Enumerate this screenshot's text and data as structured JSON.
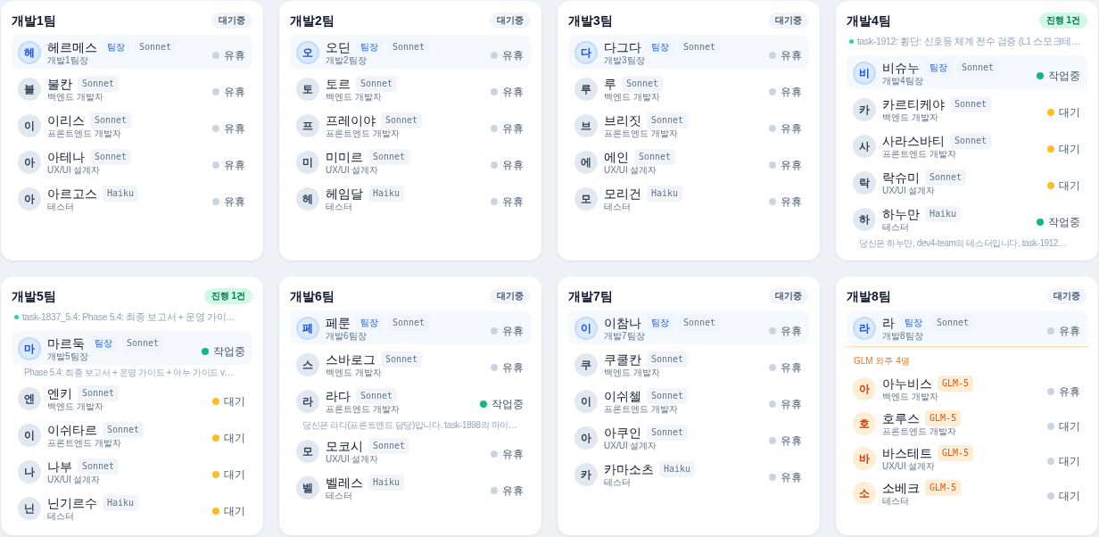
{
  "teams": [
    {
      "title": "개발1팀",
      "badge": {
        "text": "대기중",
        "active": false
      },
      "members": [
        {
          "kind": "leader",
          "initial": "헤",
          "name": "헤르메스",
          "tags": [
            {
              "text": "팀장",
              "kind": "role"
            },
            {
              "text": "Sonnet",
              "kind": "model"
            }
          ],
          "role": "개발1팀장",
          "status": "유휴",
          "color": "#cbd5e1"
        },
        {
          "kind": "member",
          "initial": "불",
          "name": "불칸",
          "tags": [
            {
              "text": "Sonnet",
              "kind": "model"
            }
          ],
          "role": "백엔드 개발자",
          "status": "유휴",
          "color": "#cbd5e1"
        },
        {
          "kind": "member",
          "initial": "이",
          "name": "이리스",
          "tags": [
            {
              "text": "Sonnet",
              "kind": "model"
            }
          ],
          "role": "프론트엔드 개발자",
          "status": "유휴",
          "color": "#cbd5e1"
        },
        {
          "kind": "member",
          "initial": "아",
          "name": "아테나",
          "tags": [
            {
              "text": "Sonnet",
              "kind": "model"
            }
          ],
          "role": "UX/UI 설계자",
          "status": "유휴",
          "color": "#cbd5e1"
        },
        {
          "kind": "member",
          "initial": "아",
          "name": "아르고스",
          "tags": [
            {
              "text": "Haiku",
              "kind": "model"
            }
          ],
          "role": "테스터",
          "status": "유휴",
          "color": "#cbd5e1"
        }
      ]
    },
    {
      "title": "개발2팀",
      "badge": {
        "text": "대기중",
        "active": false
      },
      "members": [
        {
          "kind": "leader",
          "initial": "오",
          "name": "오딘",
          "tags": [
            {
              "text": "팀장",
              "kind": "role"
            },
            {
              "text": "Sonnet",
              "kind": "model"
            }
          ],
          "role": "개발2팀장",
          "status": "유휴",
          "color": "#cbd5e1"
        },
        {
          "kind": "member",
          "initial": "토",
          "name": "토르",
          "tags": [
            {
              "text": "Sonnet",
              "kind": "model"
            }
          ],
          "role": "백엔드 개발자",
          "status": "유휴",
          "color": "#cbd5e1"
        },
        {
          "kind": "member",
          "initial": "프",
          "name": "프레이야",
          "tags": [
            {
              "text": "Sonnet",
              "kind": "model"
            }
          ],
          "role": "프론트엔드 개발자",
          "status": "유휴",
          "color": "#cbd5e1"
        },
        {
          "kind": "member",
          "initial": "미",
          "name": "미미르",
          "tags": [
            {
              "text": "Sonnet",
              "kind": "model"
            }
          ],
          "role": "UX/UI 설계자",
          "status": "유휴",
          "color": "#cbd5e1"
        },
        {
          "kind": "member",
          "initial": "헤",
          "name": "헤임달",
          "tags": [
            {
              "text": "Haiku",
              "kind": "model"
            }
          ],
          "role": "테스터",
          "status": "유휴",
          "color": "#cbd5e1"
        }
      ]
    },
    {
      "title": "개발3팀",
      "badge": {
        "text": "대기중",
        "active": false
      },
      "members": [
        {
          "kind": "leader",
          "initial": "다",
          "name": "다그다",
          "tags": [
            {
              "text": "팀장",
              "kind": "role"
            },
            {
              "text": "Sonnet",
              "kind": "model"
            }
          ],
          "role": "개발3팀장",
          "status": "유휴",
          "color": "#cbd5e1"
        },
        {
          "kind": "member",
          "initial": "루",
          "name": "루",
          "tags": [
            {
              "text": "Sonnet",
              "kind": "model"
            }
          ],
          "role": "백엔드 개발자",
          "status": "유휴",
          "color": "#cbd5e1"
        },
        {
          "kind": "member",
          "initial": "브",
          "name": "브리짓",
          "tags": [
            {
              "text": "Sonnet",
              "kind": "model"
            }
          ],
          "role": "프론트엔드 개발자",
          "status": "유휴",
          "color": "#cbd5e1"
        },
        {
          "kind": "member",
          "initial": "에",
          "name": "에인",
          "tags": [
            {
              "text": "Sonnet",
              "kind": "model"
            }
          ],
          "role": "UX/UI 설계자",
          "status": "유휴",
          "color": "#cbd5e1"
        },
        {
          "kind": "member",
          "initial": "모",
          "name": "모리건",
          "tags": [
            {
              "text": "Haiku",
              "kind": "model"
            }
          ],
          "role": "테스터",
          "status": "유휴",
          "color": "#cbd5e1"
        }
      ]
    },
    {
      "title": "개발4팀",
      "badge": {
        "text": "진행 1건",
        "active": true
      },
      "task": "task-1912: 횡단: 신호등 체계 전수 검증 (L1 스모크테…",
      "members": [
        {
          "kind": "leader",
          "initial": "비",
          "name": "비슈누",
          "tags": [
            {
              "text": "팀장",
              "kind": "role"
            },
            {
              "text": "Sonnet",
              "kind": "model"
            }
          ],
          "role": "개발4팀장",
          "status": "작업중",
          "color": "#10b981"
        },
        {
          "kind": "member",
          "initial": "카",
          "name": "카르티케야",
          "tags": [
            {
              "text": "Sonnet",
              "kind": "model"
            }
          ],
          "role": "백엔드 개발자",
          "status": "대기",
          "color": "#fbbf24"
        },
        {
          "kind": "member",
          "initial": "사",
          "name": "사라스바티",
          "tags": [
            {
              "text": "Sonnet",
              "kind": "model"
            }
          ],
          "role": "프론트엔드 개발자",
          "status": "대기",
          "color": "#fbbf24"
        },
        {
          "kind": "member",
          "initial": "락",
          "name": "락슈미",
          "tags": [
            {
              "text": "Sonnet",
              "kind": "model"
            }
          ],
          "role": "UX/UI 설계자",
          "status": "대기",
          "color": "#fbbf24"
        },
        {
          "kind": "member",
          "initial": "하",
          "name": "하누만",
          "tags": [
            {
              "text": "Haiku",
              "kind": "model"
            }
          ],
          "role": "테스터",
          "status": "작업중",
          "color": "#10b981",
          "note": "당신은 하누만, dev4-team의 테스터입니다. task-1912…"
        }
      ]
    },
    {
      "title": "개발5팀",
      "badge": {
        "text": "진행 1건",
        "active": true
      },
      "task": "task-1837_5.4: Phase 5.4: 최종 보고서 + 운영 가이…",
      "members": [
        {
          "kind": "leader",
          "initial": "마",
          "name": "마르둑",
          "tags": [
            {
              "text": "팀장",
              "kind": "role"
            },
            {
              "text": "Sonnet",
              "kind": "model"
            }
          ],
          "role": "개발5팀장",
          "status": "작업중",
          "color": "#10b981",
          "note": "Phase 5.4: 최종 보고서 + 운영 가이드 + 아누 가이드 v…"
        },
        {
          "kind": "member",
          "initial": "엔",
          "name": "엔키",
          "tags": [
            {
              "text": "Sonnet",
              "kind": "model"
            }
          ],
          "role": "백엔드 개발자",
          "status": "대기",
          "color": "#fbbf24"
        },
        {
          "kind": "member",
          "initial": "이",
          "name": "이쉬타르",
          "tags": [
            {
              "text": "Sonnet",
              "kind": "model"
            }
          ],
          "role": "프론트엔드 개발자",
          "status": "대기",
          "color": "#fbbf24"
        },
        {
          "kind": "member",
          "initial": "나",
          "name": "나부",
          "tags": [
            {
              "text": "Sonnet",
              "kind": "model"
            }
          ],
          "role": "UX/UI 설계자",
          "status": "대기",
          "color": "#fbbf24"
        },
        {
          "kind": "member",
          "initial": "닌",
          "name": "닌기르수",
          "tags": [
            {
              "text": "Haiku",
              "kind": "model"
            }
          ],
          "role": "테스터",
          "status": "대기",
          "color": "#fbbf24"
        }
      ]
    },
    {
      "title": "개발6팀",
      "badge": {
        "text": "대기중",
        "active": false
      },
      "members": [
        {
          "kind": "leader",
          "initial": "페",
          "name": "페룬",
          "tags": [
            {
              "text": "팀장",
              "kind": "role"
            },
            {
              "text": "Sonnet",
              "kind": "model"
            }
          ],
          "role": "개발6팀장",
          "status": "유휴",
          "color": "#cbd5e1"
        },
        {
          "kind": "member",
          "initial": "스",
          "name": "스바로그",
          "tags": [
            {
              "text": "Sonnet",
              "kind": "model"
            }
          ],
          "role": "백엔드 개발자",
          "status": "유휴",
          "color": "#cbd5e1"
        },
        {
          "kind": "member",
          "initial": "라",
          "name": "라다",
          "tags": [
            {
              "text": "Sonnet",
              "kind": "model"
            }
          ],
          "role": "프론트엔드 개발자",
          "status": "작업중",
          "color": "#10b981",
          "note": "당신은 라다(프론트엔드 담당)입니다. task-1898의 마이…"
        },
        {
          "kind": "member",
          "initial": "모",
          "name": "모코시",
          "tags": [
            {
              "text": "Sonnet",
              "kind": "model"
            }
          ],
          "role": "UX/UI 설계자",
          "status": "유휴",
          "color": "#cbd5e1"
        },
        {
          "kind": "member",
          "initial": "벨",
          "name": "벨레스",
          "tags": [
            {
              "text": "Haiku",
              "kind": "model"
            }
          ],
          "role": "테스터",
          "status": "유휴",
          "color": "#cbd5e1"
        }
      ]
    },
    {
      "title": "개발7팀",
      "badge": {
        "text": "대기중",
        "active": false
      },
      "members": [
        {
          "kind": "leader",
          "initial": "이",
          "name": "이참나",
          "tags": [
            {
              "text": "팀장",
              "kind": "role"
            },
            {
              "text": "Sonnet",
              "kind": "model"
            }
          ],
          "role": "개발7팀장",
          "status": "유휴",
          "color": "#cbd5e1"
        },
        {
          "kind": "member",
          "initial": "쿠",
          "name": "쿠쿨칸",
          "tags": [
            {
              "text": "Sonnet",
              "kind": "model"
            }
          ],
          "role": "백엔드 개발자",
          "status": "유휴",
          "color": "#cbd5e1"
        },
        {
          "kind": "member",
          "initial": "이",
          "name": "이쉬첼",
          "tags": [
            {
              "text": "Sonnet",
              "kind": "model"
            }
          ],
          "role": "프론트엔드 개발자",
          "status": "유휴",
          "color": "#cbd5e1"
        },
        {
          "kind": "member",
          "initial": "아",
          "name": "아쿠인",
          "tags": [
            {
              "text": "Sonnet",
              "kind": "model"
            }
          ],
          "role": "UX/UI 설계자",
          "status": "유휴",
          "color": "#cbd5e1"
        },
        {
          "kind": "member",
          "initial": "카",
          "name": "카마소츠",
          "tags": [
            {
              "text": "Haiku",
              "kind": "model"
            }
          ],
          "role": "테스터",
          "status": "유휴",
          "color": "#cbd5e1"
        }
      ]
    },
    {
      "title": "개발8팀",
      "badge": {
        "text": "대기중",
        "active": false
      },
      "members": [
        {
          "kind": "leader",
          "initial": "라",
          "name": "라",
          "tags": [
            {
              "text": "팀장",
              "kind": "role"
            },
            {
              "text": "Sonnet",
              "kind": "model"
            }
          ],
          "role": "개발8팀장",
          "status": "유휴",
          "color": "#cbd5e1"
        }
      ],
      "outsourced": {
        "label": "GLM 외주 4명",
        "members": [
          {
            "kind": "outsourced",
            "initial": "아",
            "name": "아누비스",
            "tags": [
              {
                "text": "GLM-5",
                "kind": "vendor"
              }
            ],
            "role": "백엔드 개발자",
            "status": "유휴",
            "color": "#cbd5e1"
          },
          {
            "kind": "outsourced",
            "initial": "호",
            "name": "호루스",
            "tags": [
              {
                "text": "GLM-5",
                "kind": "vendor"
              }
            ],
            "role": "프론트엔드 개발자",
            "status": "대기",
            "color": "#cbd5e1"
          },
          {
            "kind": "outsourced",
            "initial": "바",
            "name": "바스테트",
            "tags": [
              {
                "text": "GLM-5",
                "kind": "vendor"
              }
            ],
            "role": "UX/UI 설계자",
            "status": "대기",
            "color": "#cbd5e1"
          },
          {
            "kind": "outsourced",
            "initial": "소",
            "name": "소베크",
            "tags": [
              {
                "text": "GLM-5",
                "kind": "vendor"
              }
            ],
            "role": "테스터",
            "status": "대기",
            "color": "#cbd5e1"
          }
        ]
      }
    }
  ]
}
